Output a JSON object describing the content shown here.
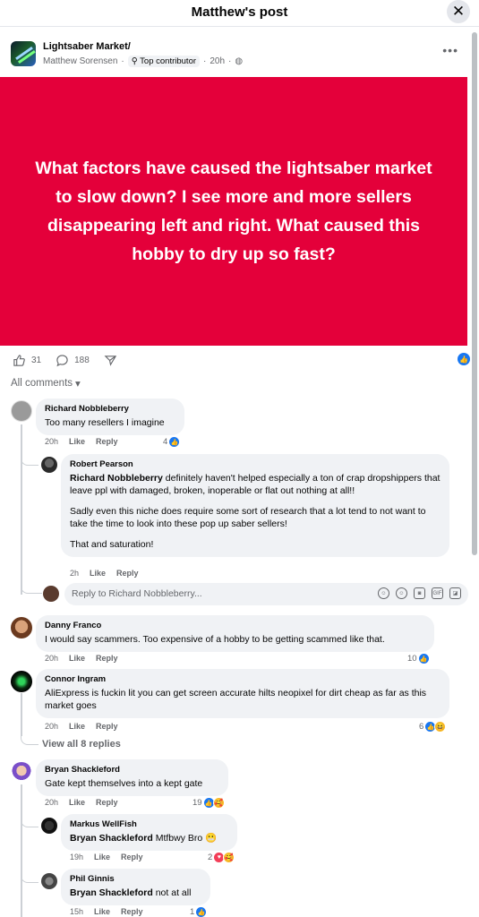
{
  "header": {
    "title": "Matthew's post",
    "close": "✕"
  },
  "post": {
    "group": "Lightsaber Market/",
    "author": "Matthew Sorensen",
    "badge": "Top contributor",
    "time": "20h",
    "banner_text": "What factors have caused the lightsaber market to slow down? I see more and more sellers disappearing left and right. What caused this hobby to dry up so fast?",
    "likes": "31",
    "comments": "188",
    "brand_color": "#e4003a"
  },
  "comments_sort": "All comments",
  "comments": [
    {
      "name": "Richard Nobbleberry",
      "text": "Too many resellers I imagine",
      "time": "20h",
      "like": "Like",
      "reply": "Reply",
      "reactions": "4"
    },
    {
      "name": "Robert Pearson",
      "mention": "Richard Nobbleberry",
      "text1": " definitely haven't helped especially a ton of crap dropshippers that leave ppl with damaged, broken, inoperable or flat out nothing at all!!",
      "text2": "Sadly even this niche does require some sort of research that a lot tend to not want to take the time to look into these pop up saber sellers!",
      "text3": "That and saturation!",
      "time": "2h",
      "like": "Like",
      "reply": "Reply"
    },
    {
      "name": "Danny Franco",
      "text": "I would say scammers. Too expensive of a hobby to be getting scammed like that.",
      "time": "20h",
      "like": "Like",
      "reply": "Reply",
      "reactions": "10"
    },
    {
      "name": "Connor Ingram",
      "text": "AliExpress is fuckin lit you can get screen accurate hilts neopixel for dirt cheap as far as this market goes",
      "time": "20h",
      "like": "Like",
      "reply": "Reply",
      "reactions": "6"
    },
    {
      "name": "Bryan Shackleford",
      "text": "Gate kept themselves into a kept gate",
      "time": "20h",
      "like": "Like",
      "reply": "Reply",
      "reactions": "19"
    },
    {
      "name": "Markus WellFish",
      "mention": "Bryan Shackleford",
      "text": " Mtfbwy Bro",
      "time": "19h",
      "like": "Like",
      "reply": "Reply",
      "reactions": "2"
    },
    {
      "name": "Phil Ginnis",
      "mention": "Bryan Shackleford",
      "text": " not at all",
      "time": "15h",
      "like": "Like",
      "reply": "Reply",
      "reactions": "1"
    }
  ],
  "reply_placeholder": "Reply to Richard Nobbleberry...",
  "view_all": "View all 8 replies"
}
